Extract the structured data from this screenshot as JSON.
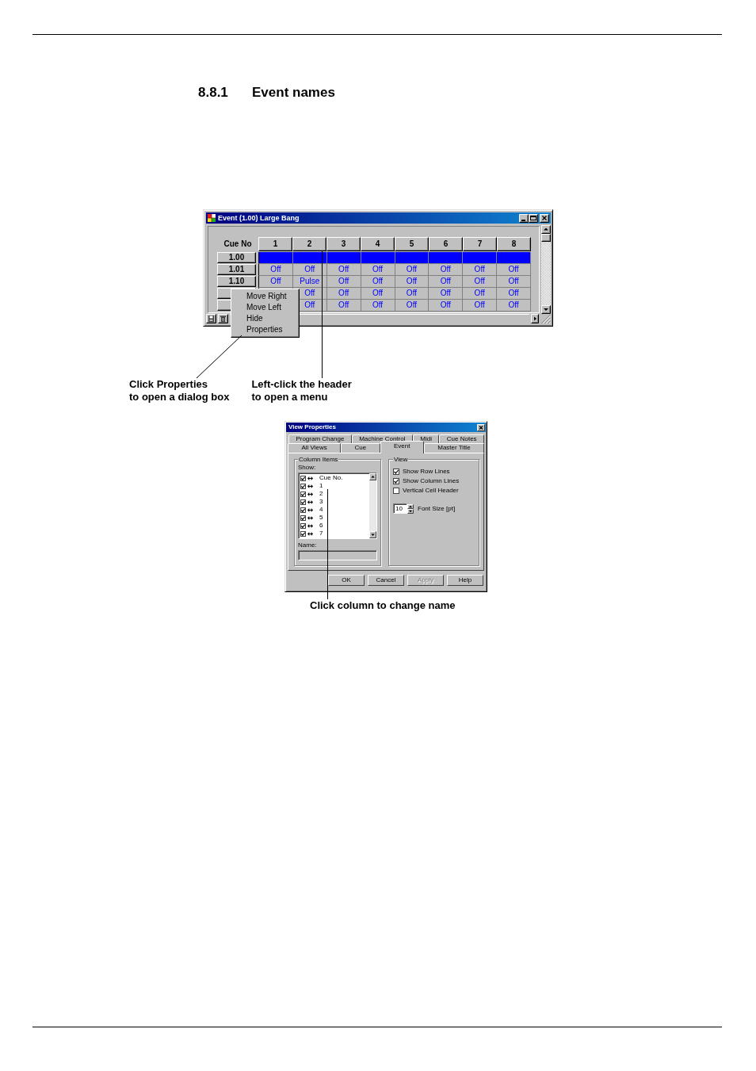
{
  "heading": {
    "number": "8.8.1",
    "title": "Event names"
  },
  "event_window": {
    "title": "Event (1.00) Large Bang",
    "corner_label": "Cue No",
    "columns": [
      "1",
      "2",
      "3",
      "4",
      "5",
      "6",
      "7",
      "8"
    ],
    "rows": [
      {
        "label": "1.00",
        "selected": true
      },
      {
        "label": "1.01",
        "selected": false,
        "cells": [
          "Off",
          "Off",
          "Off",
          "Off",
          "Off",
          "Off",
          "Off",
          "Off"
        ]
      },
      {
        "label": "1.10",
        "selected": false,
        "cells": [
          "Off",
          "Pulse",
          "Off",
          "Off",
          "Off",
          "Off",
          "Off",
          "Off"
        ]
      },
      {
        "selected": false,
        "cells": [
          "Off",
          "Off",
          "Off",
          "Off",
          "Off",
          "Off",
          "Off"
        ]
      },
      {
        "selected": false,
        "cells": [
          "Off",
          "Off",
          "Off",
          "Off",
          "Off",
          "Off",
          "Off"
        ]
      }
    ],
    "context_menu": [
      "Move Right",
      "Move Left",
      "Hide",
      "Properties"
    ]
  },
  "callouts": [
    {
      "text": "Click Properties\nto open a dialog box"
    },
    {
      "text": "Left-click the header\nto open a menu"
    }
  ],
  "view_properties": {
    "title": "View Properties",
    "tab_rows": [
      [
        {
          "label": "Program Change",
          "selected": false
        },
        {
          "label": "Machine Control",
          "selected": false
        },
        {
          "label": "Midi",
          "selected": false
        },
        {
          "label": "Cue Notes",
          "selected": false
        }
      ],
      [
        {
          "label": "All Views",
          "selected": false
        },
        {
          "label": "Cue",
          "selected": false
        },
        {
          "label": "Event",
          "selected": true
        },
        {
          "label": "Master Title",
          "selected": false
        }
      ]
    ],
    "column_items": {
      "title": "Column Items",
      "show_label": "Show:",
      "items": [
        {
          "label": "Cue No.",
          "checked": true
        },
        {
          "label": "1",
          "checked": true
        },
        {
          "label": "2",
          "checked": true
        },
        {
          "label": "3",
          "checked": true
        },
        {
          "label": "4",
          "checked": true
        },
        {
          "label": "5",
          "checked": true
        },
        {
          "label": "6",
          "checked": true
        },
        {
          "label": "7",
          "checked": true
        }
      ],
      "name_label": "Name:",
      "name_field": {
        "disabled": true
      }
    },
    "view": {
      "title": "View",
      "options": [
        {
          "label": "Show Row Lines",
          "checked": true
        },
        {
          "label": "Show Column Lines",
          "checked": true
        },
        {
          "label": "Vertical Cell Header",
          "checked": false
        }
      ],
      "font_size": {
        "value": "10",
        "label": "Font Size [pt]"
      }
    },
    "buttons": [
      {
        "label": "OK",
        "disabled": false
      },
      {
        "label": "Cancel",
        "disabled": false
      },
      {
        "label": "Apply",
        "disabled": true
      },
      {
        "label": "Help",
        "disabled": false
      }
    ]
  },
  "dialog_callout": {
    "text": "Click column to change name"
  }
}
